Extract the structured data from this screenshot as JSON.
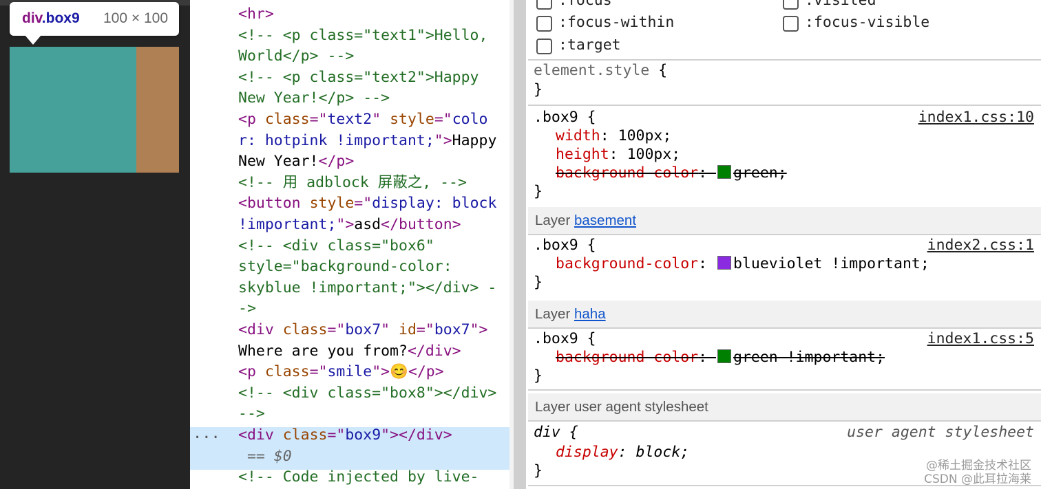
{
  "viewport": {
    "tooltip": {
      "tag": "div",
      "class": ".box9",
      "size": "100 × 100"
    },
    "box_color": "#46A19A",
    "margin_color": "#AE8053"
  },
  "elements": {
    "lines": [
      [
        [
          "tg",
          "<hr>"
        ]
      ],
      [
        [
          "cm",
          "<!-- <p class=\"text1\">Hello,"
        ]
      ],
      [
        [
          "cm",
          "World</p> -->"
        ]
      ],
      [
        [
          "cm",
          "<!-- <p class=\"text2\">Happy"
        ]
      ],
      [
        [
          "cm",
          "New Year!</p> -->"
        ]
      ],
      [
        [
          "tg",
          "<p "
        ],
        [
          "an",
          "class"
        ],
        [
          "tg",
          "=\""
        ],
        [
          "av",
          "text2"
        ],
        [
          "tg",
          "\" "
        ],
        [
          "an",
          "style"
        ],
        [
          "tg",
          "=\""
        ],
        [
          "av",
          "colo"
        ]
      ],
      [
        [
          "av",
          "r: hotpink !important;"
        ],
        [
          "tg",
          "\">"
        ],
        [
          "tx",
          "Happy"
        ]
      ],
      [
        [
          "tx",
          "New Year!"
        ],
        [
          "tg",
          "</p>"
        ]
      ],
      [
        [
          "cm",
          "<!-- 用 adblock 屏蔽之, -->"
        ]
      ],
      [
        [
          "tg",
          "<button "
        ],
        [
          "an",
          "style"
        ],
        [
          "tg",
          "=\""
        ],
        [
          "av",
          "display: block"
        ]
      ],
      [
        [
          "av",
          "!important;"
        ],
        [
          "tg",
          "\">"
        ],
        [
          "tx",
          "asd"
        ],
        [
          "tg",
          "</button>"
        ]
      ],
      [
        [
          "cm",
          "<!-- <div class=\"box6\""
        ]
      ],
      [
        [
          "cm",
          "style=\"background-color:"
        ]
      ],
      [
        [
          "cm",
          "skyblue !important;\"></div> -"
        ]
      ],
      [
        [
          "cm",
          "->"
        ]
      ],
      [
        [
          "tg",
          "<div "
        ],
        [
          "an",
          "class"
        ],
        [
          "tg",
          "=\""
        ],
        [
          "av",
          "box7"
        ],
        [
          "tg",
          "\" "
        ],
        [
          "an",
          "id"
        ],
        [
          "tg",
          "=\""
        ],
        [
          "av",
          "box7"
        ],
        [
          "tg",
          "\">"
        ]
      ],
      [
        [
          "tx",
          "Where are you from?"
        ],
        [
          "tg",
          "</div>"
        ]
      ],
      [
        [
          "tg",
          "<p "
        ],
        [
          "an",
          "class"
        ],
        [
          "tg",
          "=\""
        ],
        [
          "av",
          "smile"
        ],
        [
          "tg",
          "\">"
        ],
        [
          "tx",
          "😊"
        ],
        [
          "tg",
          "</p>"
        ]
      ],
      [
        [
          "cm",
          "<!-- <div class=\"box8\"></div>"
        ]
      ],
      [
        [
          "cm",
          "-->"
        ]
      ],
      [
        [
          "tg",
          "<div "
        ],
        [
          "an",
          "class"
        ],
        [
          "tg",
          "=\""
        ],
        [
          "av",
          "box9"
        ],
        [
          "tg",
          "\"></div>"
        ]
      ],
      [
        [
          "dollar",
          " == $0"
        ]
      ],
      [
        [
          "cm",
          "<!-- Code injected by live-"
        ]
      ]
    ],
    "selected_index": 20,
    "ellipsis": "···"
  },
  "styles": {
    "pseudo_states": [
      {
        "label": ":focus",
        "col": 0,
        "row": 0
      },
      {
        "label": ":visited",
        "col": 1,
        "row": 0
      },
      {
        "label": ":focus-within",
        "col": 0,
        "row": 1
      },
      {
        "label": ":focus-visible",
        "col": 1,
        "row": 1
      },
      {
        "label": ":target",
        "col": 0,
        "row": 2
      }
    ],
    "element_style": {
      "selector": "element.style",
      "open": " {",
      "close": "}"
    },
    "rules": [
      {
        "selector": ".box9",
        "source": "index1.css:10",
        "props": [
          {
            "name": "width",
            "value": "100px;",
            "struck": false
          },
          {
            "name": "height",
            "value": "100px;",
            "struck": false
          },
          {
            "name": "background-color",
            "value": "green;",
            "struck": true,
            "swatch": "#008000"
          }
        ]
      },
      {
        "layer": "basement",
        "selector": ".box9",
        "source": "index2.css:1",
        "props": [
          {
            "name": "background-color",
            "value": "blueviolet !important;",
            "struck": false,
            "swatch": "#8A2BE2"
          }
        ]
      },
      {
        "layer": "haha",
        "selector": ".box9",
        "source": "index1.css:5",
        "props": [
          {
            "name": "background-color",
            "value": "green !important;",
            "struck": true,
            "swatch": "#008000"
          }
        ]
      }
    ],
    "layer_prefix": "Layer",
    "ua_layer_label": "Layer user agent stylesheet",
    "ua_rule": {
      "selector": "div",
      "source": "user agent stylesheet",
      "prop": "display",
      "value": "block;"
    },
    "watermark": [
      "@稀土掘金技术社区",
      "CSDN @此耳拉海莱"
    ]
  }
}
